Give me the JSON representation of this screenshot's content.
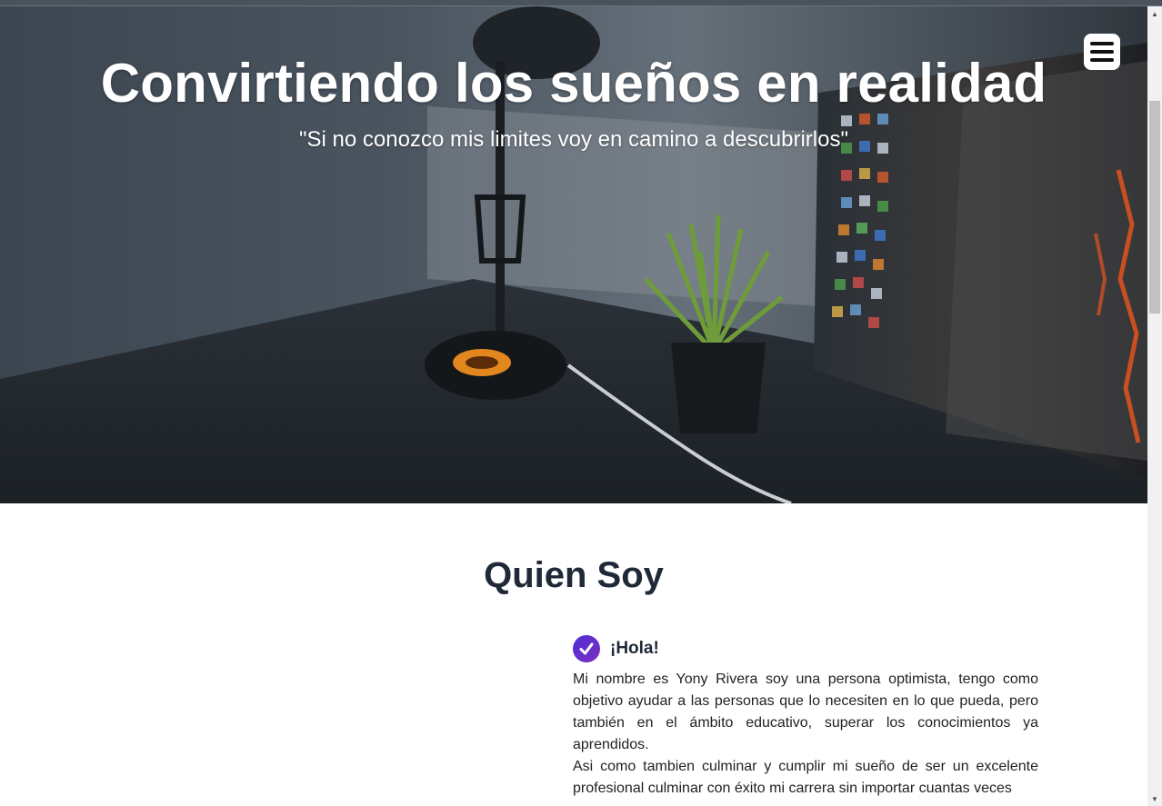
{
  "hero": {
    "title": "Convirtiendo los sueños en realidad",
    "quote": "\"Si no conozco mis limites voy en camino a descubrirlos\""
  },
  "nav": {
    "menu_icon": "hamburger-menu-icon"
  },
  "about": {
    "title": "Quien Soy",
    "greeting": "¡Hola!",
    "check_icon": "check-circle-icon",
    "paragraph1": "Mi nombre es Yony Rivera soy una persona optimista, tengo como objetivo ayudar a las personas que lo necesiten en lo que pueda, pero también en el ámbito educativo, superar los conocimientos ya aprendidos.",
    "paragraph2": "Asi como tambien culminar y cumplir mi sueño de ser un excelente profesional culminar con éxito mi carrera sin importar cuantas veces"
  },
  "colors": {
    "accent_start": "#4f2fd6",
    "accent_end": "#7b2fbf",
    "heading_text": "#1f2937"
  }
}
